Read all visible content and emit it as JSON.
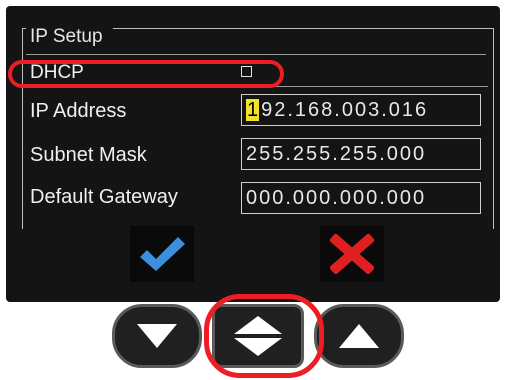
{
  "panel": {
    "title": "IP Setup"
  },
  "fields": {
    "dhcp": {
      "label": "DHCP",
      "checked": false
    },
    "ip_address": {
      "label": "IP Address",
      "cursor_char": "1",
      "value_rest": "92.168.003.016"
    },
    "subnet_mask": {
      "label": "Subnet Mask",
      "value": "255.255.255.000"
    },
    "default_gateway": {
      "label": "Default Gateway",
      "value": "000.000.000.000"
    }
  },
  "actions": {
    "ok_icon": "checkmark-icon",
    "cancel_icon": "x-icon"
  },
  "navigation": {
    "down_icon": "down-arrow-icon",
    "updown_icon": "up-down-arrow-icon",
    "up_icon": "up-arrow-icon"
  },
  "colors": {
    "screen_bg": "#141414",
    "highlight": "#ee1c24",
    "cursor": "#f2e22c",
    "check": "#3b8fdc",
    "cross": "#e02020"
  }
}
